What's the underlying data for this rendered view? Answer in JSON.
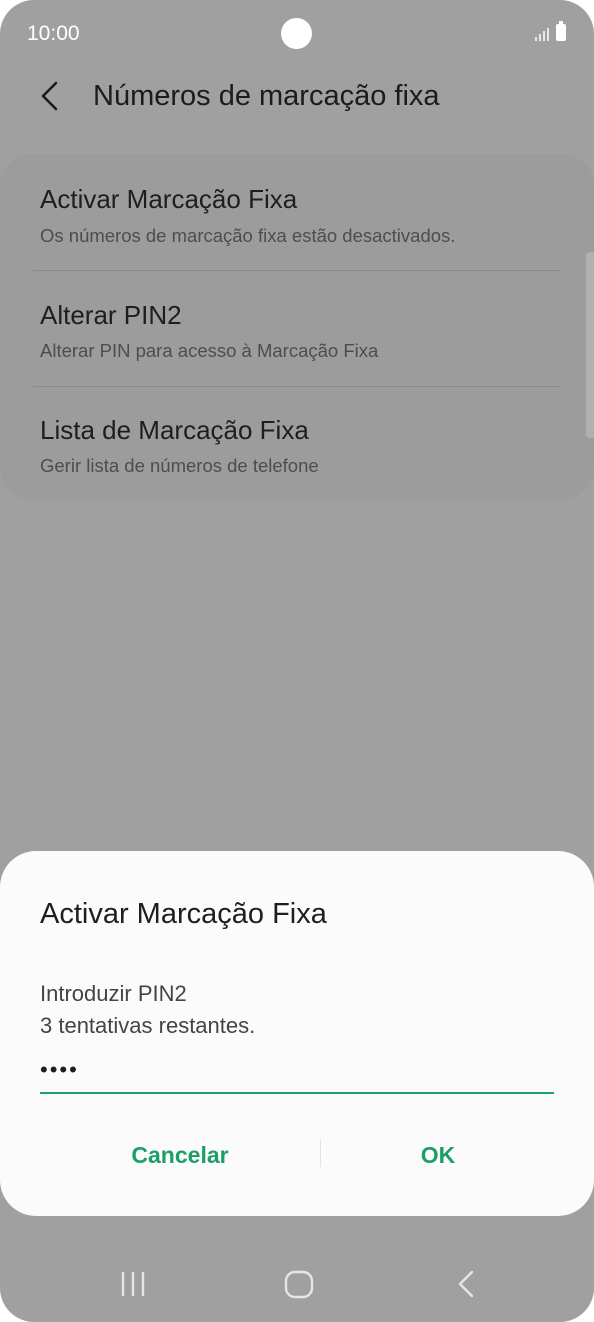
{
  "status_bar": {
    "time": "10:00"
  },
  "header": {
    "title": "Números de marcação fixa"
  },
  "settings": [
    {
      "title": "Activar Marcação Fixa",
      "subtitle": "Os números de marcação fixa estão desactivados."
    },
    {
      "title": "Alterar PIN2",
      "subtitle": "Alterar PIN para acesso à Marcação Fixa"
    },
    {
      "title": "Lista de Marcação Fixa",
      "subtitle": "Gerir lista de números de telefone"
    }
  ],
  "dialog": {
    "title": "Activar Marcação Fixa",
    "message_line1": "Introduzir PIN2",
    "message_line2": "3 tentativas restantes.",
    "pin_value": "••••",
    "cancel_label": "Cancelar",
    "ok_label": "OK"
  },
  "colors": {
    "accent": "#1c9f66",
    "scrim_background": "#a0a0a0",
    "dialog_background": "#fbfbfb"
  },
  "icons": {
    "back": "chevron-left-icon",
    "signal": "signal-icon",
    "battery": "battery-icon",
    "nav_recents": "recents-icon",
    "nav_home": "home-icon",
    "nav_back": "back-icon"
  }
}
